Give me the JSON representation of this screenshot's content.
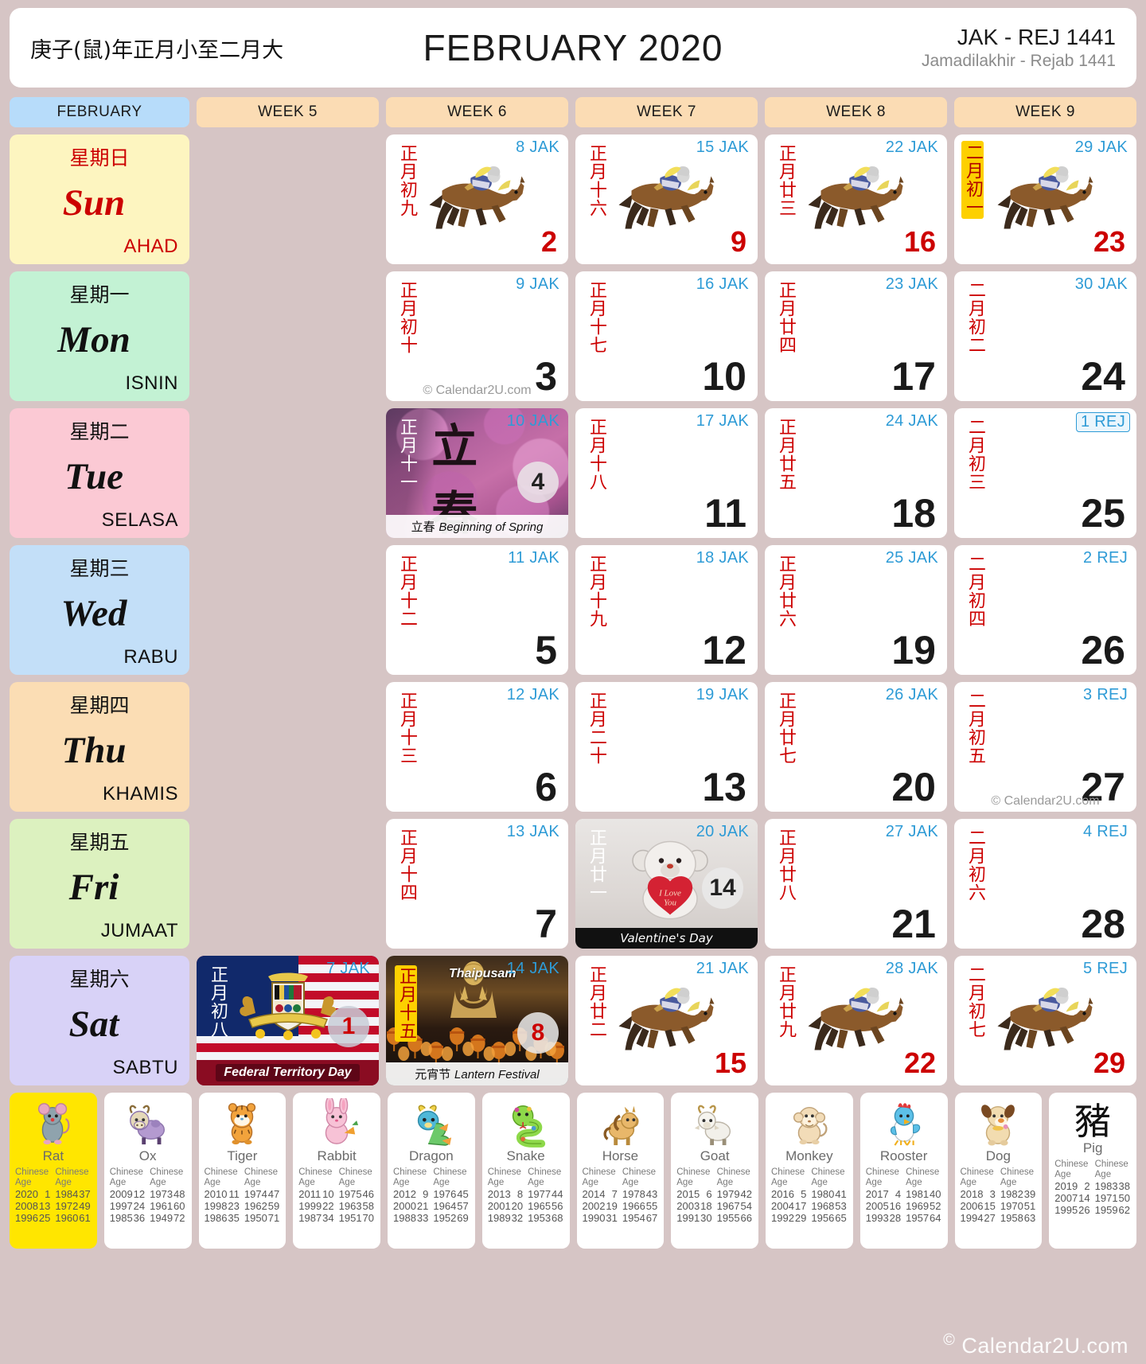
{
  "header": {
    "chinese_year": "庚子(鼠)年正月小至二月大",
    "title": "FEBRUARY 2020",
    "hijri_short": "JAK - REJ 1441",
    "hijri_long": "Jamadilakhir - Rejab 1441"
  },
  "weekbar": {
    "month": "FEBRUARY",
    "weeks": [
      "WEEK 5",
      "WEEK 6",
      "WEEK 7",
      "WEEK 8",
      "WEEK 9"
    ]
  },
  "days": [
    {
      "cn": "星期日",
      "en": "Sun",
      "ms": "AHAD",
      "color": "#fdf5c0"
    },
    {
      "cn": "星期一",
      "en": "Mon",
      "ms": "ISNIN",
      "color": "#c3f2d4"
    },
    {
      "cn": "星期二",
      "en": "Tue",
      "ms": "SELASA",
      "color": "#fbc9d4"
    },
    {
      "cn": "星期三",
      "en": "Wed",
      "ms": "RABU",
      "color": "#c3dff8"
    },
    {
      "cn": "星期四",
      "en": "Thu",
      "ms": "KHAMIS",
      "color": "#fbddb4"
    },
    {
      "cn": "星期五",
      "en": "Fri",
      "ms": "JUMAAT",
      "color": "#dcf1bf"
    },
    {
      "cn": "星期六",
      "en": "Sat",
      "ms": "SABTU",
      "color": "#d8d2f7"
    }
  ],
  "cells": {
    "w5_sun": {
      "empty": true
    },
    "w5_mon": {
      "empty": true
    },
    "w5_tue": {
      "empty": true
    },
    "w5_wed": {
      "empty": true
    },
    "w5_thu": {
      "empty": true
    },
    "w5_fri": {
      "empty": true
    },
    "w5_sat": {
      "hijri": "7 JAK",
      "lunar": "正月初八",
      "day": "1",
      "type": "holiday-flag",
      "label": "Federal Territory Day"
    },
    "w6_sun": {
      "hijri": "8 JAK",
      "lunar": "正月初九",
      "day": "2",
      "type": "horse"
    },
    "w6_mon": {
      "hijri": "9 JAK",
      "lunar": "正月初十",
      "day": "3",
      "type": "plain",
      "watermark": "© Calendar2U.com"
    },
    "w6_tue": {
      "hijri": "10 JAK",
      "lunar": "正月十一",
      "day": "4",
      "type": "spring",
      "art_text": "立春",
      "label_cn": "立春",
      "label_en": "Beginning of Spring"
    },
    "w6_wed": {
      "hijri": "11 JAK",
      "lunar": "正月十二",
      "day": "5",
      "type": "plain"
    },
    "w6_thu": {
      "hijri": "12 JAK",
      "lunar": "正月十三",
      "day": "6",
      "type": "plain"
    },
    "w6_fri": {
      "hijri": "13 JAK",
      "lunar": "正月十四",
      "day": "7",
      "type": "plain"
    },
    "w6_sat": {
      "hijri": "14 JAK",
      "lunar": "正月十五",
      "day": "8",
      "type": "lantern",
      "top_label": "Thaipusam",
      "label_cn": "元宵节",
      "label_en": "Lantern Festival"
    },
    "w7_sun": {
      "hijri": "15 JAK",
      "lunar": "正月十六",
      "day": "9",
      "type": "horse"
    },
    "w7_mon": {
      "hijri": "16 JAK",
      "lunar": "正月十七",
      "day": "10",
      "type": "plain"
    },
    "w7_tue": {
      "hijri": "17 JAK",
      "lunar": "正月十八",
      "day": "11",
      "type": "plain"
    },
    "w7_wed": {
      "hijri": "18 JAK",
      "lunar": "正月十九",
      "day": "12",
      "type": "plain"
    },
    "w7_thu": {
      "hijri": "19 JAK",
      "lunar": "正月二十",
      "day": "13",
      "type": "plain"
    },
    "w7_fri": {
      "hijri": "20 JAK",
      "lunar": "正月廿一",
      "day": "14",
      "type": "teddy",
      "label_en": "Valentine's Day"
    },
    "w7_sat": {
      "hijri": "21 JAK",
      "lunar": "正月廿二",
      "day": "15",
      "type": "horse"
    },
    "w8_sun": {
      "hijri": "22 JAK",
      "lunar": "正月廿三",
      "day": "16",
      "type": "horse"
    },
    "w8_mon": {
      "hijri": "23 JAK",
      "lunar": "正月廿四",
      "day": "17",
      "type": "plain"
    },
    "w8_tue": {
      "hijri": "24 JAK",
      "lunar": "正月廿五",
      "day": "18",
      "type": "plain"
    },
    "w8_wed": {
      "hijri": "25 JAK",
      "lunar": "正月廿六",
      "day": "19",
      "type": "plain"
    },
    "w8_thu": {
      "hijri": "26 JAK",
      "lunar": "正月廿七",
      "day": "20",
      "type": "plain"
    },
    "w8_fri": {
      "hijri": "27 JAK",
      "lunar": "正月廿八",
      "day": "21",
      "type": "plain"
    },
    "w8_sat": {
      "hijri": "28 JAK",
      "lunar": "正月廿九",
      "day": "22",
      "type": "horse"
    },
    "w9_sun": {
      "hijri": "29 JAK",
      "lunar": "二月初一",
      "day": "23",
      "type": "horse",
      "lunar_highlight": true
    },
    "w9_mon": {
      "hijri": "30 JAK",
      "lunar": "二月初二",
      "day": "24",
      "type": "plain"
    },
    "w9_tue": {
      "hijri": "1 REJ",
      "lunar": "二月初三",
      "day": "25",
      "type": "plain",
      "hijri_boxed": true
    },
    "w9_wed": {
      "hijri": "2 REJ",
      "lunar": "二月初四",
      "day": "26",
      "type": "plain"
    },
    "w9_thu": {
      "hijri": "3 REJ",
      "lunar": "二月初五",
      "day": "27",
      "type": "plain",
      "watermark": "© Calendar2U.com"
    },
    "w9_fri": {
      "hijri": "4 REJ",
      "lunar": "二月初六",
      "day": "28",
      "type": "plain"
    },
    "w9_sat": {
      "hijri": "5 REJ",
      "lunar": "二月初七",
      "day": "29",
      "type": "horse"
    }
  },
  "zodiac": {
    "col_head": "Chinese Age",
    "animals": [
      {
        "name": "Rat",
        "left": [
          [
            "2020",
            "1"
          ],
          [
            "2008",
            "13"
          ],
          [
            "1996",
            "25"
          ]
        ],
        "right": [
          [
            "1984",
            "37"
          ],
          [
            "1972",
            "49"
          ],
          [
            "1960",
            "61"
          ]
        ]
      },
      {
        "name": "Ox",
        "left": [
          [
            "2009",
            "12"
          ],
          [
            "1997",
            "24"
          ],
          [
            "1985",
            "36"
          ]
        ],
        "right": [
          [
            "1973",
            "48"
          ],
          [
            "1961",
            "60"
          ],
          [
            "1949",
            "72"
          ]
        ]
      },
      {
        "name": "Tiger",
        "left": [
          [
            "2010",
            "11"
          ],
          [
            "1998",
            "23"
          ],
          [
            "1986",
            "35"
          ]
        ],
        "right": [
          [
            "1974",
            "47"
          ],
          [
            "1962",
            "59"
          ],
          [
            "1950",
            "71"
          ]
        ]
      },
      {
        "name": "Rabbit",
        "left": [
          [
            "2011",
            "10"
          ],
          [
            "1999",
            "22"
          ],
          [
            "1987",
            "34"
          ]
        ],
        "right": [
          [
            "1975",
            "46"
          ],
          [
            "1963",
            "58"
          ],
          [
            "1951",
            "70"
          ]
        ]
      },
      {
        "name": "Dragon",
        "left": [
          [
            "2012",
            "9"
          ],
          [
            "2000",
            "21"
          ],
          [
            "1988",
            "33"
          ]
        ],
        "right": [
          [
            "1976",
            "45"
          ],
          [
            "1964",
            "57"
          ],
          [
            "1952",
            "69"
          ]
        ]
      },
      {
        "name": "Snake",
        "left": [
          [
            "2013",
            "8"
          ],
          [
            "2001",
            "20"
          ],
          [
            "1989",
            "32"
          ]
        ],
        "right": [
          [
            "1977",
            "44"
          ],
          [
            "1965",
            "56"
          ],
          [
            "1953",
            "68"
          ]
        ]
      },
      {
        "name": "Horse",
        "left": [
          [
            "2014",
            "7"
          ],
          [
            "2002",
            "19"
          ],
          [
            "1990",
            "31"
          ]
        ],
        "right": [
          [
            "1978",
            "43"
          ],
          [
            "1966",
            "55"
          ],
          [
            "1954",
            "67"
          ]
        ]
      },
      {
        "name": "Goat",
        "left": [
          [
            "2015",
            "6"
          ],
          [
            "2003",
            "18"
          ],
          [
            "1991",
            "30"
          ]
        ],
        "right": [
          [
            "1979",
            "42"
          ],
          [
            "1967",
            "54"
          ],
          [
            "1955",
            "66"
          ]
        ]
      },
      {
        "name": "Monkey",
        "left": [
          [
            "2016",
            "5"
          ],
          [
            "2004",
            "17"
          ],
          [
            "1992",
            "29"
          ]
        ],
        "right": [
          [
            "1980",
            "41"
          ],
          [
            "1968",
            "53"
          ],
          [
            "1956",
            "65"
          ]
        ]
      },
      {
        "name": "Rooster",
        "left": [
          [
            "2017",
            "4"
          ],
          [
            "2005",
            "16"
          ],
          [
            "1993",
            "28"
          ]
        ],
        "right": [
          [
            "1981",
            "40"
          ],
          [
            "1969",
            "52"
          ],
          [
            "1957",
            "64"
          ]
        ]
      },
      {
        "name": "Dog",
        "left": [
          [
            "2018",
            "3"
          ],
          [
            "2006",
            "15"
          ],
          [
            "1994",
            "27"
          ]
        ],
        "right": [
          [
            "1982",
            "39"
          ],
          [
            "1970",
            "51"
          ],
          [
            "1958",
            "63"
          ]
        ]
      },
      {
        "name": "Pig",
        "glyph": "豬",
        "left": [
          [
            "2019",
            "2"
          ],
          [
            "2007",
            "14"
          ],
          [
            "1995",
            "26"
          ]
        ],
        "right": [
          [
            "1983",
            "38"
          ],
          [
            "1971",
            "50"
          ],
          [
            "1959",
            "62"
          ]
        ]
      }
    ]
  },
  "footer": {
    "copyright": "Calendar2U.com",
    "symbol": "©"
  }
}
